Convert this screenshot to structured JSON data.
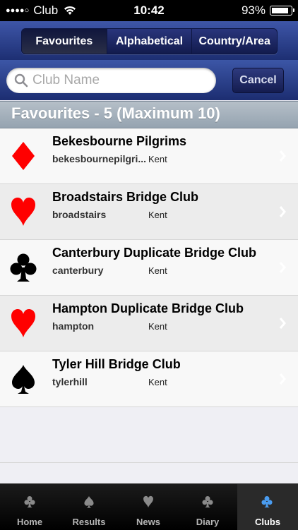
{
  "status_bar": {
    "carrier": "Club",
    "time": "10:42",
    "battery": "93%",
    "battery_level": 0.93
  },
  "segments": [
    {
      "label": "Favourites",
      "active": true
    },
    {
      "label": "Alphabetical",
      "active": false
    },
    {
      "label": "Country/Area",
      "active": false
    }
  ],
  "search": {
    "placeholder": "Club Name",
    "cancel_label": "Cancel"
  },
  "section_header": "Favourites - 5 (Maximum 10)",
  "clubs": [
    {
      "name": "Bekesbourne Pilgrims",
      "code": "bekesbournepilgri...",
      "county": "Kent",
      "suit": "diamond",
      "suit_color": "#ff0000"
    },
    {
      "name": "Broadstairs Bridge Club",
      "code": "broadstairs",
      "county": "Kent",
      "suit": "heart",
      "suit_color": "#ff0000"
    },
    {
      "name": "Canterbury Duplicate Bridge Club",
      "code": "canterbury",
      "county": "Kent",
      "suit": "club",
      "suit_color": "#000000"
    },
    {
      "name": "Hampton Duplicate Bridge Club",
      "code": "hampton",
      "county": "Kent",
      "suit": "heart",
      "suit_color": "#ff0000"
    },
    {
      "name": "Tyler Hill Bridge Club",
      "code": "tylerhill",
      "county": "Kent",
      "suit": "spade",
      "suit_color": "#000000"
    }
  ],
  "tabs": [
    {
      "label": "Home",
      "icon": "club-icon",
      "active": false
    },
    {
      "label": "Results",
      "icon": "spade-icon",
      "active": false
    },
    {
      "label": "News",
      "icon": "heart-icon",
      "active": false
    },
    {
      "label": "Diary",
      "icon": "club-icon",
      "active": false
    },
    {
      "label": "Clubs",
      "icon": "club-icon",
      "active": true
    }
  ],
  "colors": {
    "nav_top": "#3e56a8",
    "nav_bottom": "#1d2f73",
    "red_suit": "#ff0000",
    "active_tab_icon": "#4a9cf0"
  }
}
